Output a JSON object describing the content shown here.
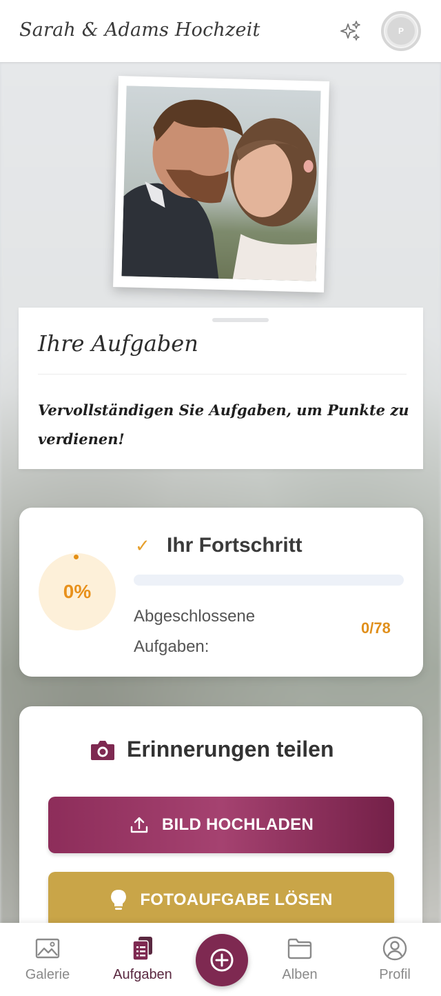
{
  "header": {
    "title": "Sarah & Adams Hochzeit",
    "sparkle_icon": "sparkles-icon",
    "avatar_initial": "P"
  },
  "photo": {
    "alt": "couple-photo"
  },
  "tasks": {
    "title": "Ihre Aufgaben",
    "subtitle": "Vervollständigen Sie Aufgaben, um Punkte zu verdienen!"
  },
  "progress": {
    "title": "Ihr Fortschritt",
    "percent_label": "0%",
    "percent_value": 0,
    "completed_label": "Abgeschlossene Aufgaben:",
    "completed_count": "0/78",
    "accent_color": "#e8911c"
  },
  "share": {
    "title": "Erinnerungen teilen",
    "upload_label": "BILD HOCHLADEN",
    "task_label": "FOTOAUFGABE LÖSEN",
    "upload_color": "#8d2d5a",
    "task_color": "#c9a548"
  },
  "nav": {
    "items": [
      {
        "label": "Galerie",
        "icon": "image-icon",
        "active": false
      },
      {
        "label": "Aufgaben",
        "icon": "tasks-icon",
        "active": true
      },
      {
        "label": "Alben",
        "icon": "folder-icon",
        "active": false
      },
      {
        "label": "Profil",
        "icon": "user-circle-icon",
        "active": false
      }
    ],
    "fab_icon": "plus-circle-icon",
    "brand_color": "#7e2951"
  }
}
